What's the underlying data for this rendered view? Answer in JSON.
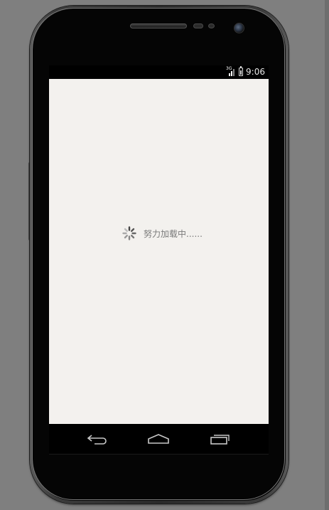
{
  "status_bar": {
    "network": "3G",
    "time": "9:06",
    "icons": [
      "signal-icon",
      "battery-icon"
    ]
  },
  "screen": {
    "background": "#f3f1ee",
    "loading_text": "努力加载中......",
    "spinner_icon": "spinner-icon"
  },
  "nav_bar": {
    "icons": [
      "back-icon",
      "home-icon",
      "recent-apps-icon"
    ]
  },
  "device": {
    "frame": "Galaxy Nexus emulator skin"
  }
}
